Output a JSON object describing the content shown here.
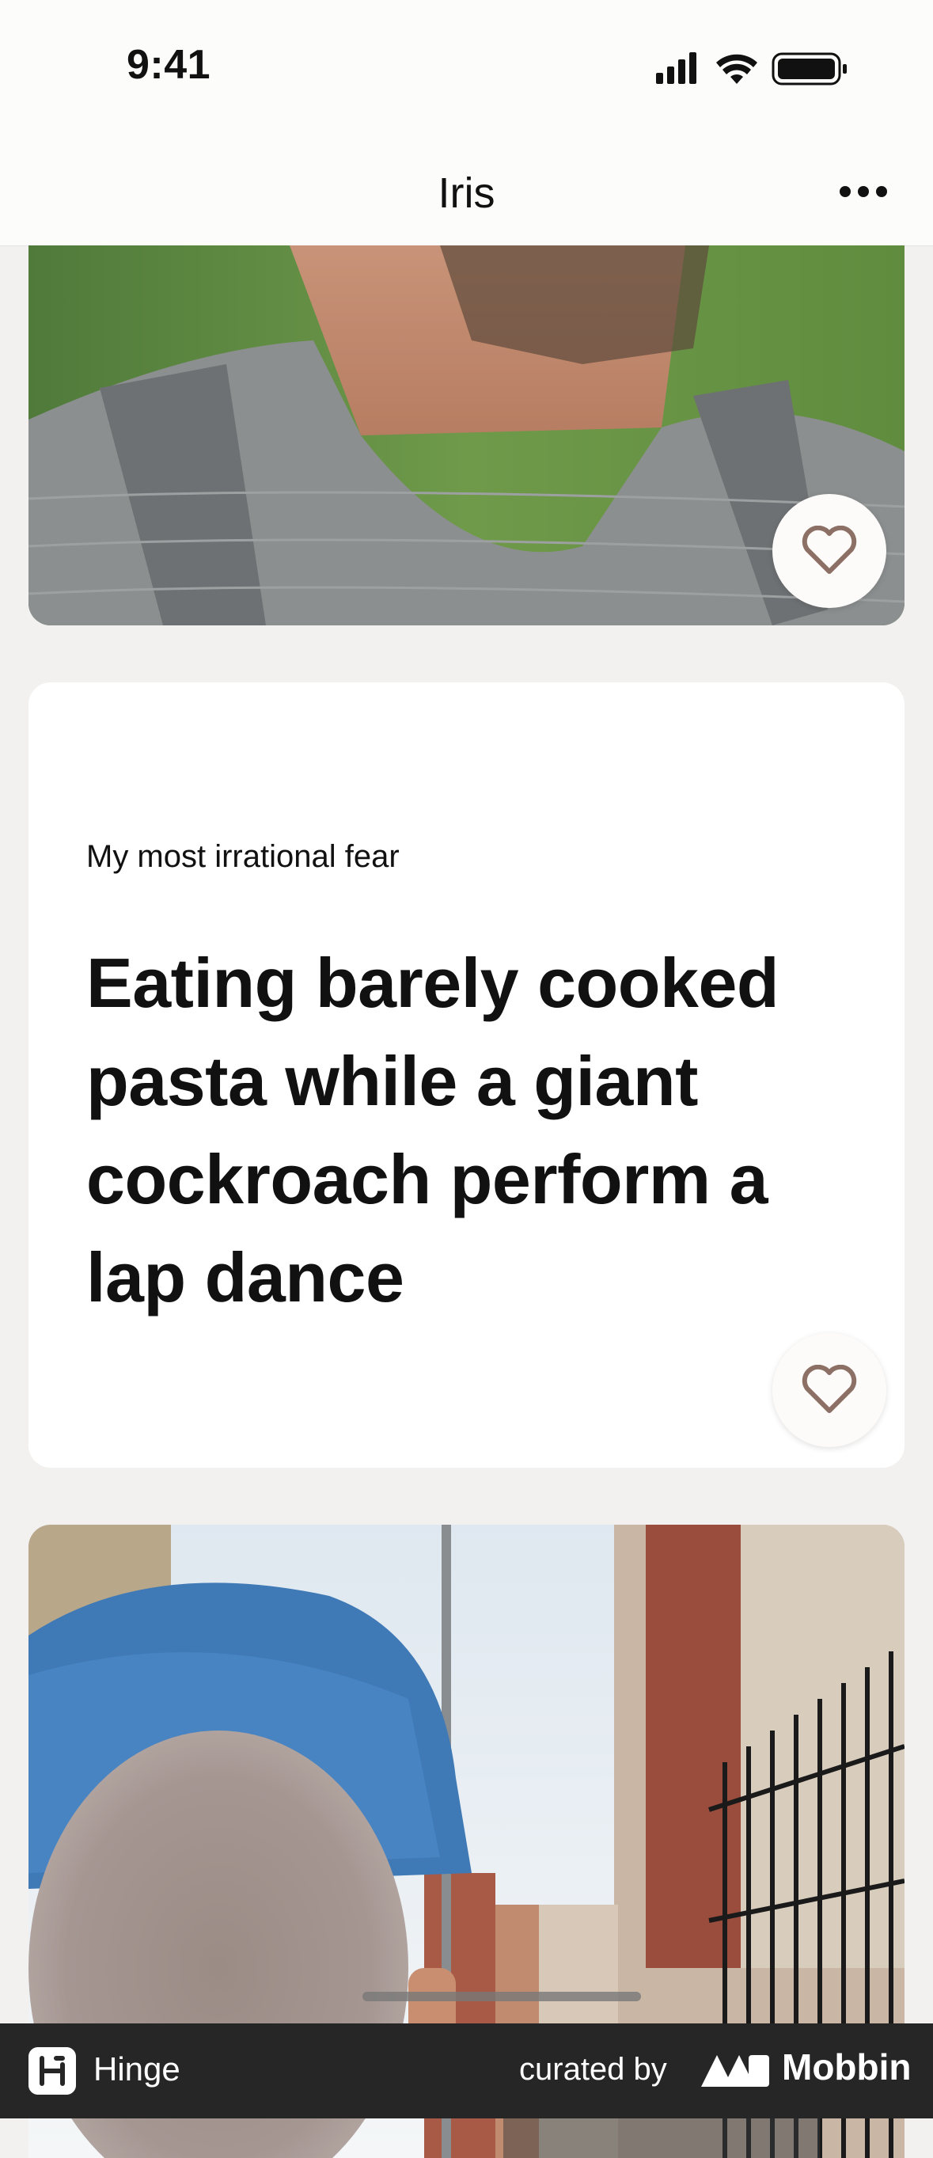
{
  "status_bar": {
    "time": "9:41"
  },
  "nav": {
    "title": "Iris"
  },
  "profile": {
    "photo1": {
      "alt": "photo"
    },
    "prompt": {
      "question": "My most irrational fear",
      "answer": "Eating barely cooked pasta while a giant cockroach perform a lap dance"
    },
    "photo2": {
      "alt": "photo"
    }
  },
  "footer": {
    "app_name": "Hinge",
    "curated_by": "curated by",
    "brand": "Mobbin"
  },
  "colors": {
    "background": "#f2f1f0",
    "card": "#ffffff",
    "heart_stroke": "#8c6f65",
    "footer": "#262626"
  }
}
